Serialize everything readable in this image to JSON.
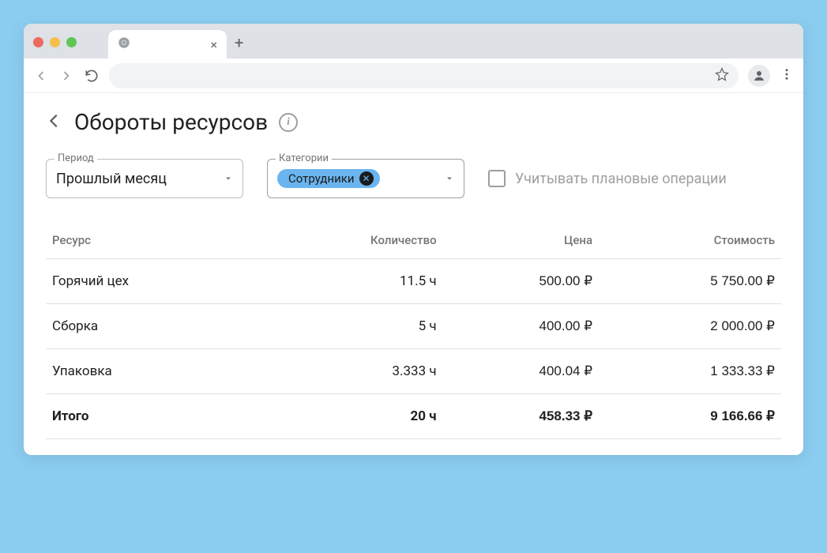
{
  "page": {
    "title": "Обороты ресурсов"
  },
  "filters": {
    "period_label": "Период",
    "period_value": "Прошлый месяц",
    "category_label": "Категории",
    "category_chip": "Сотрудники",
    "checkbox_label": "Учитывать плановые операции"
  },
  "table": {
    "headers": {
      "resource": "Ресурс",
      "quantity": "Количество",
      "price": "Цена",
      "cost": "Стоимость"
    },
    "rows": [
      {
        "resource": "Горячий цех",
        "quantity": "11.5 ч",
        "price": "500.00 ₽",
        "cost": "5 750.00 ₽"
      },
      {
        "resource": "Сборка",
        "quantity": "5 ч",
        "price": "400.00 ₽",
        "cost": "2 000.00 ₽"
      },
      {
        "resource": "Упаковка",
        "quantity": "3.333 ч",
        "price": "400.04 ₽",
        "cost": "1 333.33 ₽"
      }
    ],
    "total": {
      "resource": "Итого",
      "quantity": "20 ч",
      "price": "458.33 ₽",
      "cost": "9 166.66 ₽"
    }
  }
}
